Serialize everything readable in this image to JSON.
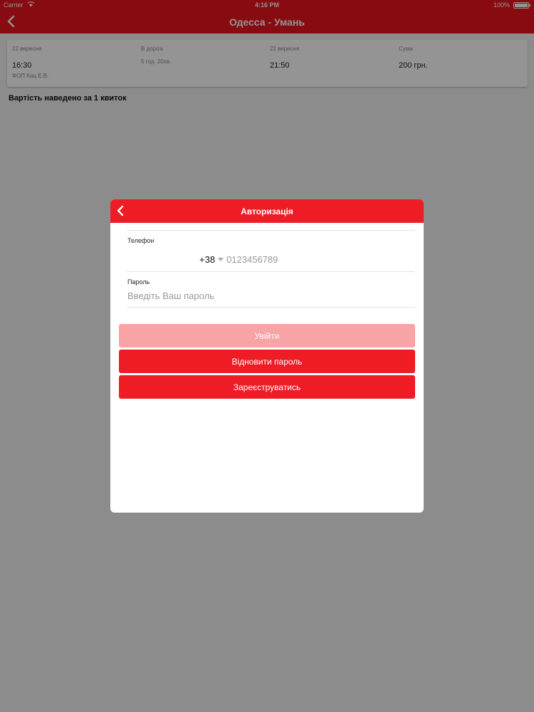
{
  "status_bar": {
    "carrier": "Carrier",
    "time": "4:16 PM",
    "battery_percent": "100%",
    "battery_level": 1.0
  },
  "nav": {
    "title": "Одесса - Умань"
  },
  "trip": {
    "departure_date": "22 вересня",
    "departure_time": "16:30",
    "duration_label": "В дорозі",
    "duration_value": "5 год. 20хв.",
    "arrival_date": "22 вересня",
    "arrival_time": "21:50",
    "price_label": "Сума",
    "price_value": "200 грн.",
    "carrier": "ФОП Кац Е.В."
  },
  "price_note": "Вартість наведено за 1 квиток",
  "modal": {
    "title": "Авторизація",
    "phone_label": "Телефон",
    "phone_code": "+38",
    "phone_placeholder": "0123456789",
    "password_label": "Пароль",
    "password_placeholder": "Введіть Ваш пароль",
    "login_button": "Увійти",
    "restore_button": "Відновити пароль",
    "register_button": "Зареєструватись"
  },
  "colors": {
    "brand_red": "#ee1c25",
    "disabled_red": "#f8a3a5"
  }
}
